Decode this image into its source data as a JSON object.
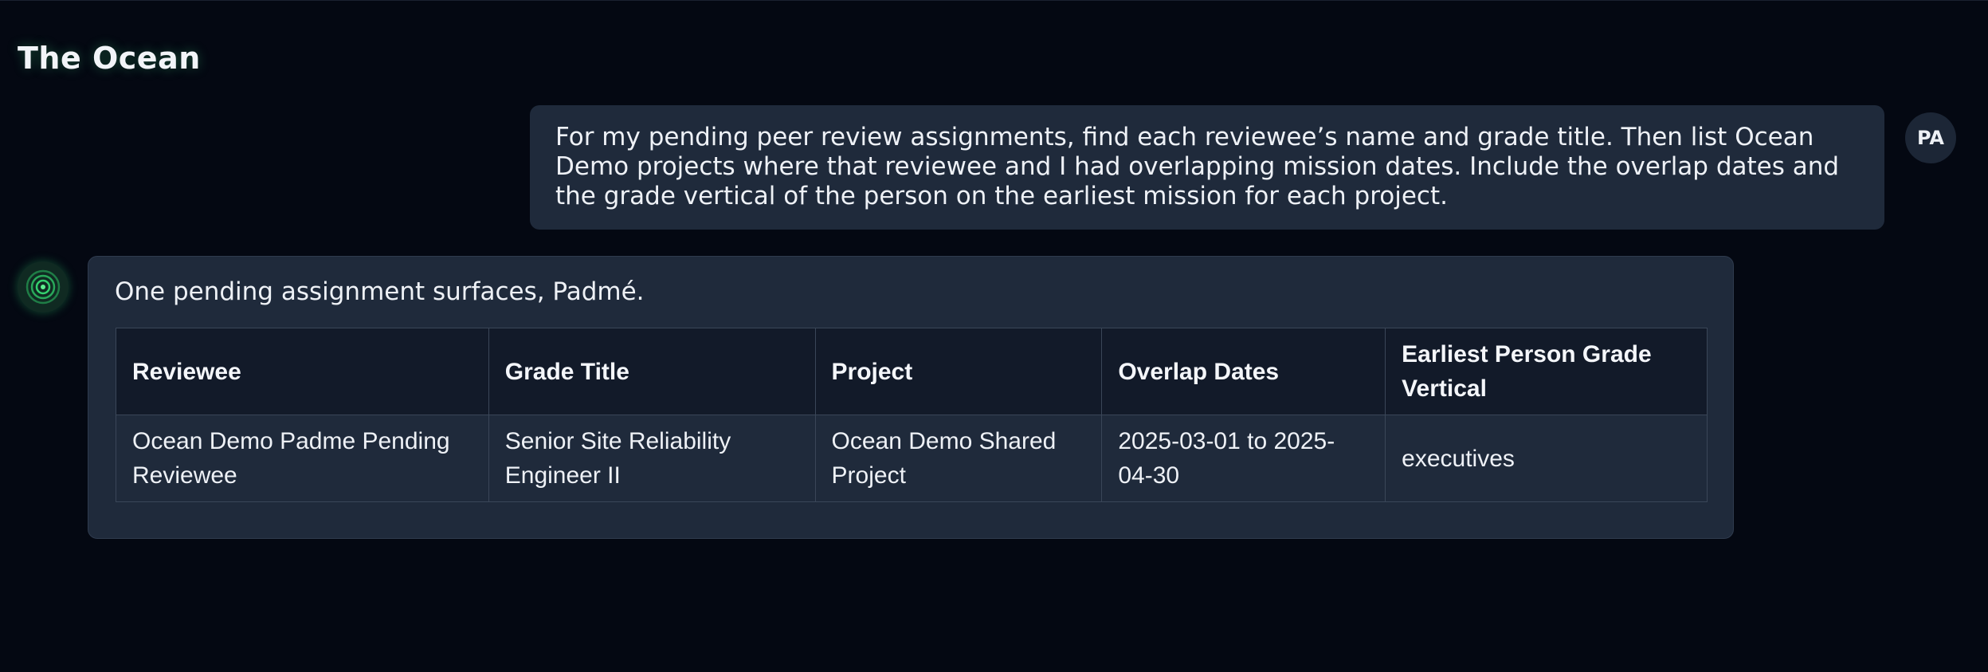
{
  "app": {
    "title": "The Ocean"
  },
  "messages": {
    "user": {
      "avatar_initials": "PA",
      "text": "For my pending peer review assignments, find each reviewee’s name and grade title. Then list Ocean Demo projects where that reviewee and I had overlapping mission dates. Include the overlap dates and the grade vertical of the person on the earliest mission for each project."
    },
    "assistant": {
      "avatar_icon": "concentric-rings-icon",
      "intro": "One pending assignment surfaces, Padmé.",
      "table": {
        "headers": [
          "Reviewee",
          "Grade Title",
          "Project",
          "Overlap Dates",
          "Earliest Person Grade Vertical"
        ],
        "rows": [
          [
            "Ocean Demo Padme Pending Reviewee",
            "Senior Site Reliability Engineer II",
            "Ocean Demo Shared Project",
            "2025-03-01 to 2025-04-30",
            "executives"
          ]
        ]
      }
    }
  },
  "colors": {
    "background": "#040812",
    "bubble": "#1f2a3b",
    "table_header": "#121a29",
    "accent_green": "#2fd06a"
  }
}
